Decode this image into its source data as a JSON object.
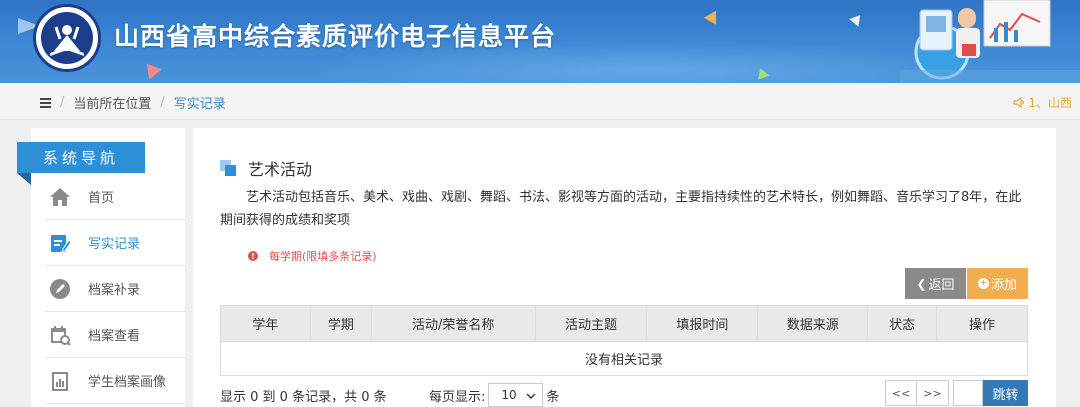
{
  "header": {
    "title": "山西省高中综合素质评价电子信息平台",
    "logo_icon": "school-emblem-icon"
  },
  "breadcrumb": {
    "label": "当前所在位置",
    "current": "写实记录",
    "notice": "1、山西"
  },
  "sidebar": {
    "heading": "系统导航",
    "items": [
      {
        "label": "首页",
        "icon": "home-icon"
      },
      {
        "label": "写实记录",
        "icon": "edit-icon",
        "active": true
      },
      {
        "label": "档案补录",
        "icon": "pencil-circle-icon"
      },
      {
        "label": "档案查看",
        "icon": "calendar-search-icon"
      },
      {
        "label": "学生档案画像",
        "icon": "chart-document-icon"
      }
    ]
  },
  "main": {
    "title": "艺术活动",
    "description": "艺术活动包括音乐、美术、戏曲、戏剧、舞蹈、书法、影视等方面的活动，主要指持续性的艺术特长，例如舞蹈、音乐学习了8年，在此期间获得的成绩和奖项",
    "hint": "每学期(限填多条记录)",
    "back_label": "返回",
    "add_label": "添加",
    "table": {
      "columns": [
        "学年",
        "学期",
        "活动/荣誉名称",
        "活动主题",
        "填报时间",
        "数据来源",
        "状态",
        "操作"
      ],
      "empty_text": "没有相关记录"
    },
    "footer": {
      "summary": "显示 0 到 0 条记录，共 0 条",
      "per_page_label": "每页显示:",
      "per_page_value": "10",
      "per_page_unit": "条",
      "first_label": "<<",
      "next_label": ">>",
      "jump_label": "跳转"
    }
  },
  "colors": {
    "accent": "#2d8fd5",
    "warning": "#f0ad4e",
    "danger": "#d9534f",
    "primary_button": "#337ab7"
  }
}
